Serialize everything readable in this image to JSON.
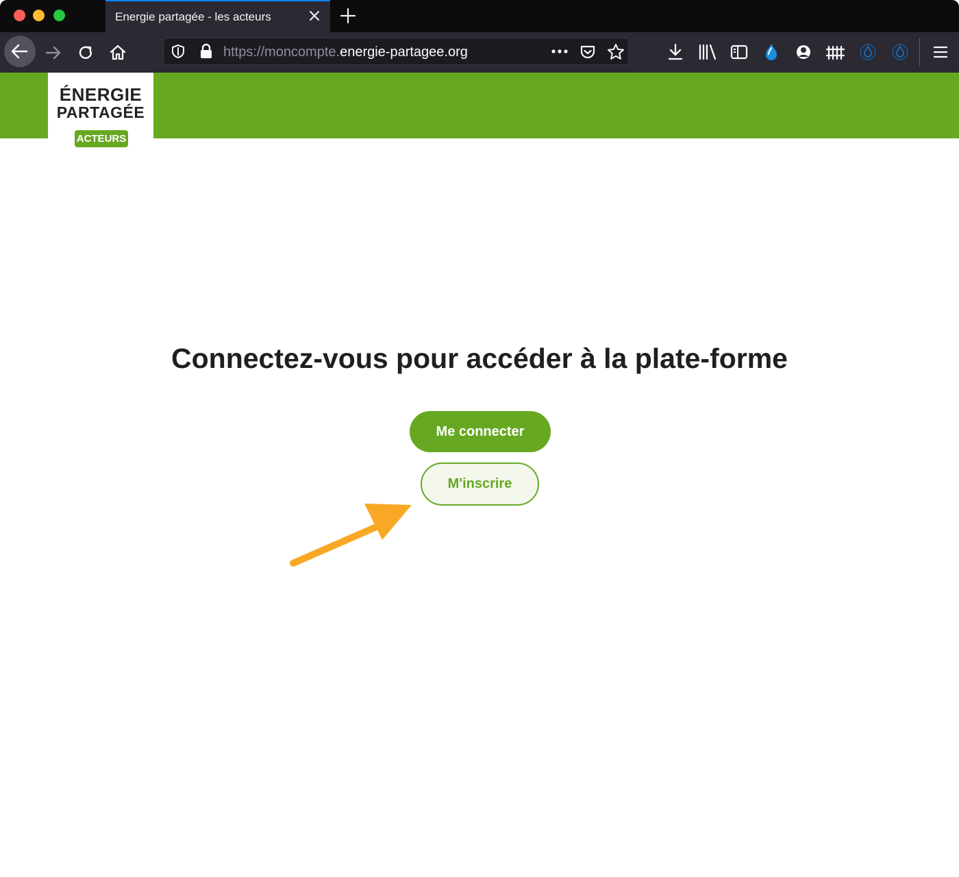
{
  "browser": {
    "tab_title": "Energie partagée - les acteurs",
    "url_prefix": "https://moncompte.",
    "url_domain": "energie-partagee.org"
  },
  "logo": {
    "line1": "ÉNERGIE",
    "line2": "PARTAGÉE",
    "badge": "ACTEURS"
  },
  "main": {
    "heading": "Connectez-vous pour accéder à la plate-forme",
    "login_label": "Me connecter",
    "signup_label": "M'inscrire"
  },
  "colors": {
    "brand_green": "#67a822",
    "annotation_arrow": "#f9a825"
  }
}
